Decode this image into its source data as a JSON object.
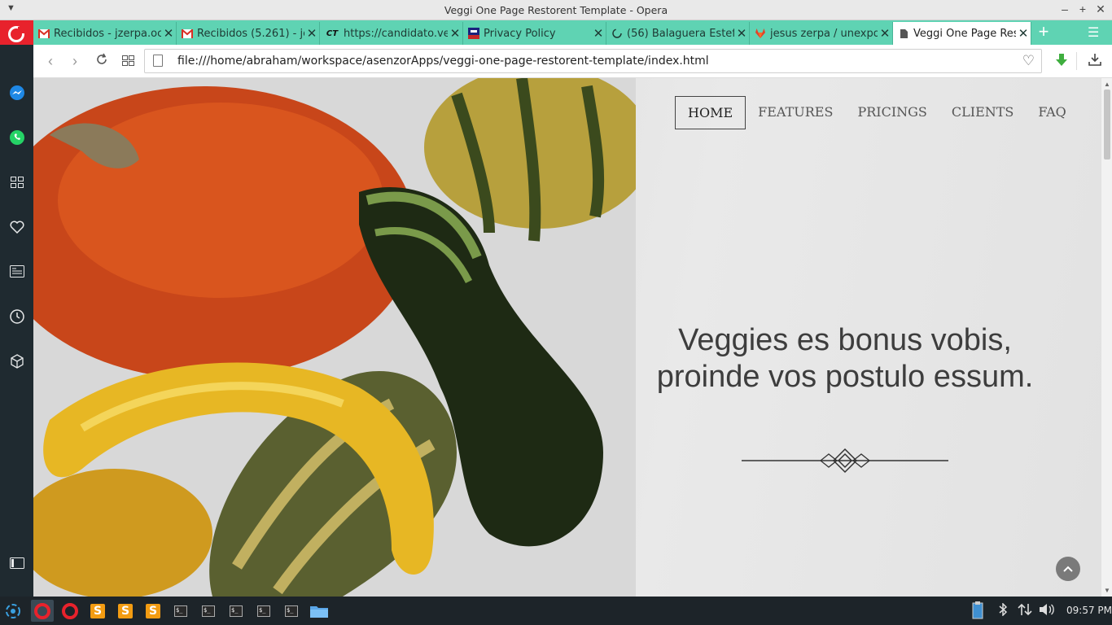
{
  "window": {
    "title": "Veggi One Page Restorent Template - Opera",
    "minimize": "–",
    "maximize": "+",
    "close": "✕"
  },
  "tabs": [
    {
      "label": "Recibidos - jzerpa.oc",
      "icon": "gmail-icon",
      "close": "✕"
    },
    {
      "label": "Recibidos (5.261) - je",
      "icon": "gmail-icon",
      "close": "✕"
    },
    {
      "label": "https://candidato.ve",
      "icon": "ct-icon",
      "icon_text": "CT",
      "close": "✕"
    },
    {
      "label": "Privacy Policy",
      "icon": "flag-icon",
      "close": "✕"
    },
    {
      "label": "(56) Balaguera Estef",
      "icon": "loading-icon",
      "close": "✕"
    },
    {
      "label": "jesus zerpa / unexpo",
      "icon": "gitlab-icon",
      "close": "✕"
    },
    {
      "label": "Veggi One Page Rest",
      "icon": "page-icon",
      "close": "✕",
      "active": true
    }
  ],
  "address_bar": {
    "url": "file:///home/abraham/workspace/asenzorApps/veggi-one-page-restorent-template/index.html"
  },
  "page": {
    "menu": [
      "HOME",
      "FEATURES",
      "PRICINGS",
      "CLIENTS",
      "FAQ"
    ],
    "active_menu": "HOME",
    "hero_text": "Veggies es bonus vobis, proinde vos postulo essum."
  },
  "taskbar": {
    "term_label": "$_",
    "sublime_label": "S",
    "clock": "09:57 PM"
  },
  "colors": {
    "tab_bg": "#5fd3b3",
    "opera_red": "#e8222c",
    "sidebar_bg": "#1f2a30",
    "taskbar_bg": "#1d2429"
  }
}
